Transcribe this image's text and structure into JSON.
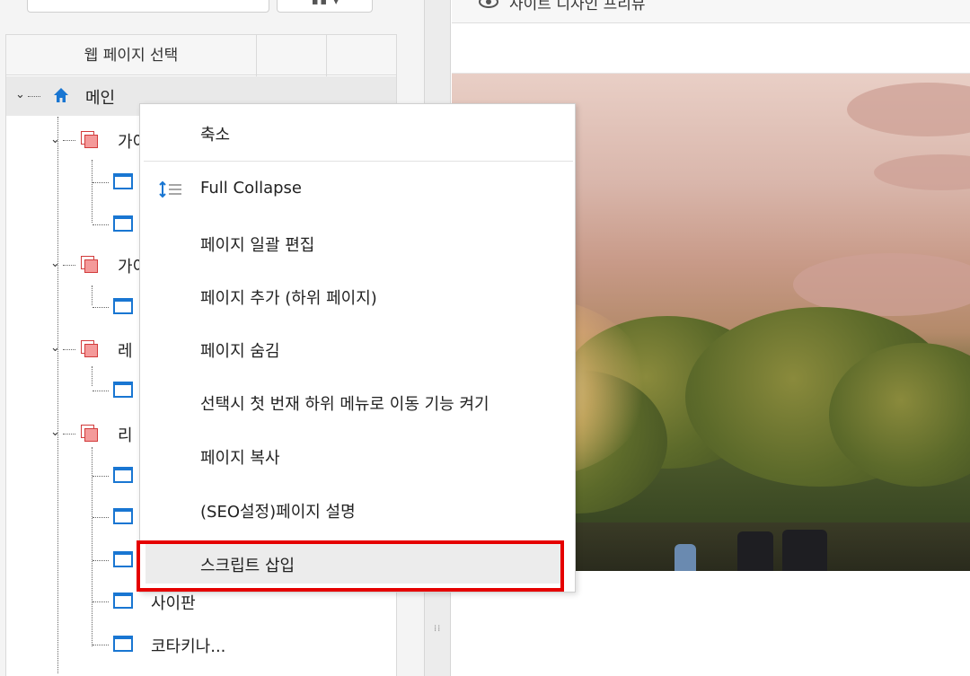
{
  "tree_panel": {
    "header": "웹 페이지 선택",
    "root_label": "메인",
    "nodes": [
      {
        "label": "가이"
      },
      {
        "label": "가이"
      },
      {
        "label": "레"
      },
      {
        "label": "리"
      },
      {
        "label": "사이판"
      },
      {
        "label": "코타키나..."
      }
    ]
  },
  "preview": {
    "title": "사이트 디자인 프리뷰"
  },
  "context_menu": {
    "items": [
      {
        "label": "축소"
      },
      {
        "label": "Full Collapse",
        "icon": "collapse-lines-icon"
      },
      {
        "label": "페이지 일괄 편집"
      },
      {
        "label": "페이지 추가 (하위 페이지)"
      },
      {
        "label": "페이지 숨김"
      },
      {
        "label": "선택시 첫 번재 하위 메뉴로 이동 기능 켜기"
      },
      {
        "label": "페이지 복사"
      },
      {
        "label": "(SEO설정)페이지 설명"
      },
      {
        "label": "스크립트 삽입"
      }
    ],
    "highlighted_index": 8,
    "highlight_color": "#e50000"
  },
  "colors": {
    "page_icon": "#1976d2",
    "folder_icon": "#d23b3b"
  }
}
